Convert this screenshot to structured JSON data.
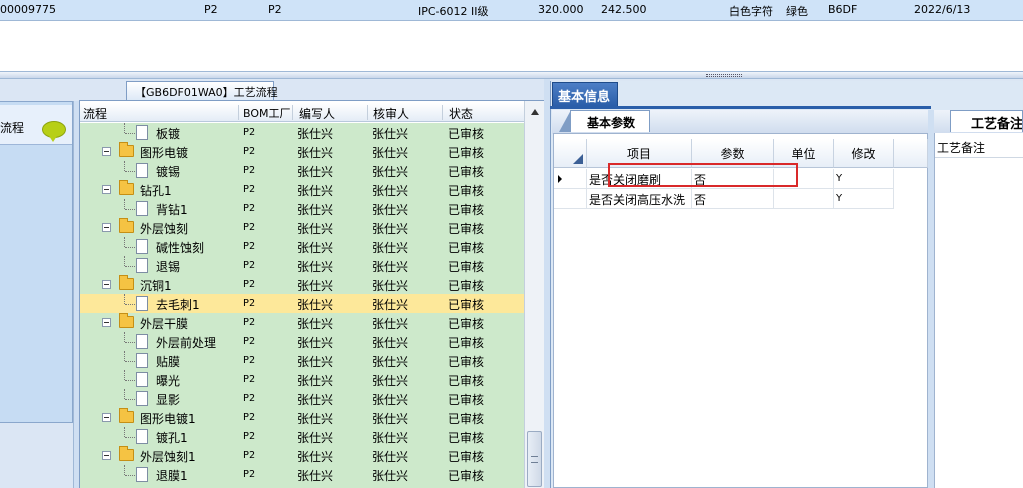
{
  "top_row": {
    "cells": [
      "00009775",
      "P2",
      "P2",
      "IPC-6012 II级",
      "320.000",
      "242.500",
      "白色字符",
      "绿色",
      "B6DF",
      "2022/6/13"
    ]
  },
  "left_nav": {
    "item_label": "流程",
    "icon": "speech-bubble-icon"
  },
  "tree": {
    "tab_label": "【GB6DF01WA0】工艺流程",
    "columns": [
      "流程",
      "BOM工厂",
      "编写人",
      "核审人",
      "状态"
    ],
    "rows": [
      {
        "name": "板镀",
        "type": "doc",
        "bom": "P2",
        "writer": "张仕兴",
        "reviewer": "张仕兴",
        "status": "已审核"
      },
      {
        "name": "图形电镀",
        "type": "folder",
        "bom": "P2",
        "writer": "张仕兴",
        "reviewer": "张仕兴",
        "status": "已审核"
      },
      {
        "name": "镀锡",
        "type": "doc",
        "bom": "P2",
        "writer": "张仕兴",
        "reviewer": "张仕兴",
        "status": "已审核"
      },
      {
        "name": "钻孔1",
        "type": "folder",
        "bom": "P2",
        "writer": "张仕兴",
        "reviewer": "张仕兴",
        "status": "已审核"
      },
      {
        "name": "背钻1",
        "type": "doc",
        "bom": "P2",
        "writer": "张仕兴",
        "reviewer": "张仕兴",
        "status": "已审核"
      },
      {
        "name": "外层蚀刻",
        "type": "folder",
        "bom": "P2",
        "writer": "张仕兴",
        "reviewer": "张仕兴",
        "status": "已审核"
      },
      {
        "name": "碱性蚀刻",
        "type": "doc",
        "bom": "P2",
        "writer": "张仕兴",
        "reviewer": "张仕兴",
        "status": "已审核"
      },
      {
        "name": "退锡",
        "type": "doc",
        "bom": "P2",
        "writer": "张仕兴",
        "reviewer": "张仕兴",
        "status": "已审核"
      },
      {
        "name": "沉铜1",
        "type": "folder",
        "bom": "P2",
        "writer": "张仕兴",
        "reviewer": "张仕兴",
        "status": "已审核"
      },
      {
        "name": "去毛刺1",
        "type": "doc",
        "bom": "P2",
        "writer": "张仕兴",
        "reviewer": "张仕兴",
        "status": "已审核",
        "selected": true
      },
      {
        "name": "外层干膜",
        "type": "folder",
        "bom": "P2",
        "writer": "张仕兴",
        "reviewer": "张仕兴",
        "status": "已审核"
      },
      {
        "name": "外层前处理",
        "type": "doc",
        "bom": "P2",
        "writer": "张仕兴",
        "reviewer": "张仕兴",
        "status": "已审核"
      },
      {
        "name": "贴膜",
        "type": "doc",
        "bom": "P2",
        "writer": "张仕兴",
        "reviewer": "张仕兴",
        "status": "已审核"
      },
      {
        "name": "曝光",
        "type": "doc",
        "bom": "P2",
        "writer": "张仕兴",
        "reviewer": "张仕兴",
        "status": "已审核"
      },
      {
        "name": "显影",
        "type": "doc",
        "bom": "P2",
        "writer": "张仕兴",
        "reviewer": "张仕兴",
        "status": "已审核"
      },
      {
        "name": "图形电镀1",
        "type": "folder",
        "bom": "P2",
        "writer": "张仕兴",
        "reviewer": "张仕兴",
        "status": "已审核"
      },
      {
        "name": "镀孔1",
        "type": "doc",
        "bom": "P2",
        "writer": "张仕兴",
        "reviewer": "张仕兴",
        "status": "已审核"
      },
      {
        "name": "外层蚀刻1",
        "type": "folder",
        "bom": "P2",
        "writer": "张仕兴",
        "reviewer": "张仕兴",
        "status": "已审核"
      },
      {
        "name": "退膜1",
        "type": "doc",
        "bom": "P2",
        "writer": "张仕兴",
        "reviewer": "张仕兴",
        "status": "已审核"
      }
    ]
  },
  "basic_info": {
    "tab_label": "基本信息",
    "sub_tab_label": "基本参数",
    "columns": [
      "项目",
      "参数",
      "单位",
      "修改"
    ],
    "rows": [
      {
        "item": "是否关闭磨刷",
        "param": "否",
        "unit": "",
        "modify": "Y"
      },
      {
        "item": "是否关闭高压水洗",
        "param": "否",
        "unit": "",
        "modify": "Y"
      }
    ]
  },
  "notes": {
    "tab_label": "工艺备注",
    "column": "工艺备注"
  },
  "colors": {
    "tree_bg": "#cde9cb",
    "selected_row": "#fde89a",
    "highlight_box": "#d9292a",
    "accent_tab": "#2a5ea9"
  }
}
